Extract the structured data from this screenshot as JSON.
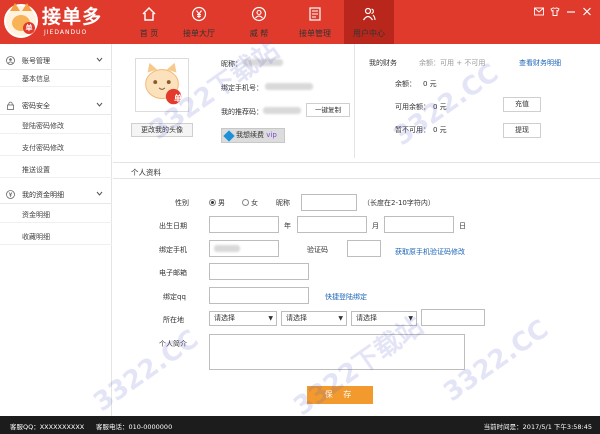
{
  "app": {
    "logo_text": "接单多",
    "logo_sub": "JIEDANDUO",
    "logo_badge": "单"
  },
  "nav": [
    {
      "label": "首 页",
      "icon": "home-icon"
    },
    {
      "label": "接单大厅",
      "icon": "yen-icon"
    },
    {
      "label": "威 帮",
      "icon": "badge-icon"
    },
    {
      "label": "接单管理",
      "icon": "document-icon"
    },
    {
      "label": "用户中心",
      "icon": "user-group-icon",
      "active": true
    }
  ],
  "window_controls": [
    "envelope-icon",
    "skin-icon",
    "minimize-icon",
    "close-icon"
  ],
  "sidebar": {
    "groups": [
      {
        "label": "账号管理",
        "icon": "account-icon",
        "items": [
          "基本信息"
        ]
      },
      {
        "label": "密码安全",
        "icon": "lock-icon",
        "items": [
          "登陆密码修改",
          "支付密码修改",
          "推送设置"
        ]
      },
      {
        "label": "我的资金明细",
        "icon": "money-icon",
        "items": [
          "资金明细",
          "收藏明细"
        ]
      }
    ]
  },
  "profile": {
    "nickname_label": "昵称：",
    "phone_label": "绑定手机号：",
    "referrer_label": "我的推荐码：",
    "copy_button": "一键复制",
    "change_avatar_button": "更改我的头像",
    "vip_button": "我想续费",
    "vip_tag": "vip",
    "avatar_badge": "单"
  },
  "finance": {
    "title": "我的财务",
    "legend": "余额：可用 + 不可用",
    "detail_link": "查看财务明细",
    "balance_label": "余额：",
    "balance_value": "0 元",
    "available_label": "可用余额：",
    "available_value": "0 元",
    "unavailable_label": "暂不可用：",
    "unavailable_value": "0 元",
    "recharge_button": "充值",
    "withdraw_button": "提现"
  },
  "form": {
    "section_title": "个人资料",
    "gender_label": "性别",
    "male": "男",
    "female": "女",
    "nickname_label": "昵称",
    "nickname_hint": "（长度在2-10字符内）",
    "birthday_label": "出生日期",
    "year": "年",
    "month": "月",
    "day": "日",
    "phone_label": "绑定手机",
    "code_label": "验证码",
    "code_link": "获取原手机验证码修改",
    "email_label": "电子邮箱",
    "qq_label": "绑定qq",
    "qq_link": "快捷登陆绑定",
    "location_label": "所在地",
    "select_placeholder": "请选择",
    "bio_label": "个人简介",
    "save_button": "保 存"
  },
  "watermark": [
    "3322下载站",
    "3322.CC"
  ],
  "footer": {
    "qq": "客服QQ：XXXXXXXXXX",
    "phone": "客服电话：010-0000000",
    "time": "当前时间是：2017/5/1 下午3:58:45"
  }
}
